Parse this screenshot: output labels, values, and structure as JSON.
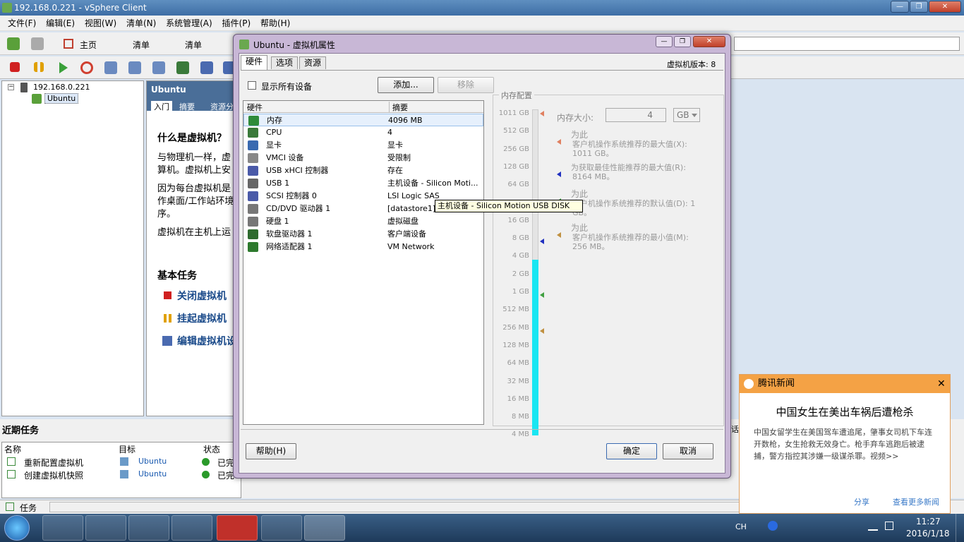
{
  "window": {
    "title": "192.168.0.221 - vSphere Client"
  },
  "menu": [
    "文件(F)",
    "编辑(E)",
    "视图(W)",
    "清单(N)",
    "系统管理(A)",
    "插件(P)",
    "帮助(H)"
  ],
  "nav": {
    "home": "主页",
    "inventory1": "清单",
    "inventory2": "清单"
  },
  "tree": {
    "host": "192.168.0.221",
    "vm": "Ubuntu"
  },
  "content": {
    "title": "Ubuntu",
    "tabs": [
      "入门",
      "摘要",
      "资源分"
    ],
    "heading": "什么是虚拟机？",
    "p1": "与物理机一样，虚",
    "p1b": "算机。虚拟机上安",
    "p2": "因为每台虚拟机是",
    "p2b": "作桌面/工作站环境",
    "p2c": "序。",
    "p3": "虚拟机在主机上运",
    "basic_tasks": "基本任务",
    "task1": "关闭虚拟机",
    "task2": "挂起虚拟机",
    "task3": "编辑虚拟机设"
  },
  "recent": {
    "title": "近期任务",
    "cols": [
      "名称",
      "目标",
      "状态"
    ],
    "rows": [
      {
        "name": "重新配置虚拟机",
        "target": "Ubuntu",
        "status": "已完"
      },
      {
        "name": "创建虚拟机快照",
        "target": "Ubuntu",
        "status": "已完"
      }
    ],
    "right_label": "话"
  },
  "statusbar": {
    "tasks": "任务"
  },
  "dialog": {
    "title": "Ubuntu - 虚拟机属性",
    "tabs": [
      "硬件",
      "选项",
      "资源"
    ],
    "vm_version": "虚拟机版本: 8",
    "show_all": "显示所有设备",
    "add": "添加...",
    "remove": "移除",
    "col_hw": "硬件",
    "col_summary": "摘要",
    "hardware": [
      {
        "name": "内存",
        "summary": "4096 MB",
        "color": "#2e8b3a"
      },
      {
        "name": "CPU",
        "summary": "4",
        "color": "#3a7a3a"
      },
      {
        "name": "显卡",
        "summary": "显卡",
        "color": "#3a6ab0"
      },
      {
        "name": "VMCI 设备",
        "summary": "受限制",
        "color": "#888888"
      },
      {
        "name": "USB xHCI 控制器",
        "summary": "存在",
        "color": "#4a5aa8"
      },
      {
        "name": "USB 1",
        "summary": "主机设备 - Silicon Moti...",
        "color": "#666666"
      },
      {
        "name": "SCSI 控制器  0",
        "summary": "LSI Logic SAS",
        "color": "#4a5aa8"
      },
      {
        "name": "CD/DVD 驱动器  1",
        "summary": "[datastore1] ...",
        "color": "#777777"
      },
      {
        "name": "硬盘  1",
        "summary": "虚拟磁盘",
        "color": "#777777"
      },
      {
        "name": "软盘驱动器  1",
        "summary": "客户端设备",
        "color": "#2e6a2e"
      },
      {
        "name": "网络适配器  1",
        "summary": "VM Network",
        "color": "#2e7a2e"
      }
    ],
    "mem_group": "内存配置",
    "mem_size_label": "内存大小:",
    "mem_size_value": "4",
    "mem_unit": "GB",
    "ticks": [
      "1011 GB",
      "512 GB",
      "256 GB",
      "128 GB",
      "64 GB",
      "32 GB",
      "16 GB",
      "8 GB",
      "4 GB",
      "2 GB",
      "1 GB",
      "512 MB",
      "256 MB",
      "128 MB",
      "64 MB",
      "32 MB",
      "16 MB",
      "8 MB",
      "4 MB"
    ],
    "legend": [
      {
        "a": "为此",
        "b": "客户机操作系统推荐的最大值(X):",
        "c": "1011 GB。",
        "color": "#e08060"
      },
      {
        "a": "",
        "b": "为获取最佳性能推荐的最大值(R):",
        "c": "8164 MB。",
        "color": "#2030c0"
      },
      {
        "a": "为此",
        "b": "客户机操作系统推荐的默认值(D): 1",
        "c": "GB。",
        "color": "#40a040"
      },
      {
        "a": "为此",
        "b": "客户机操作系统推荐的最小值(M):",
        "c": "256 MB。",
        "color": "#c09040"
      }
    ],
    "help": "帮助(H)",
    "ok": "确定",
    "cancel": "取消",
    "tooltip": "主机设备 - Silicon Motion USB DISK"
  },
  "news": {
    "source": "腾讯新闻",
    "headline": "中国女生在美出车祸后遭枪杀",
    "body": "中国女留学生在美国驾车遭追尾，肇事女司机下车连开数枪，女生抢救无效身亡。枪手弃车逃跑后被逮捕，警方指控其涉嫌一级谋杀罪。视频>>",
    "share": "分享",
    "more": "查看更多新闻"
  },
  "tray": {
    "lang": "CH",
    "time": "11:27",
    "date": "2016/1/18"
  }
}
